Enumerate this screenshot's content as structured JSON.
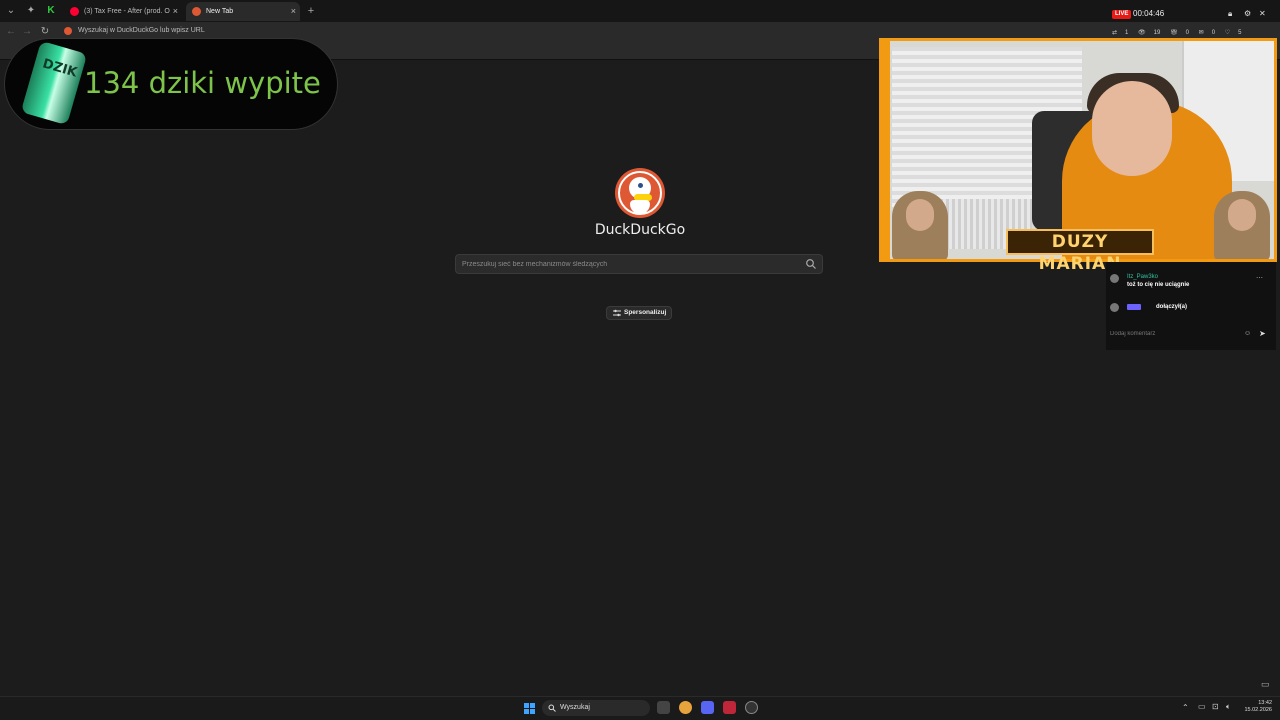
{
  "browser": {
    "tabs": [
      {
        "label": "(3) Tax Free - After (prod. O",
        "active": false
      },
      {
        "label": "New Tab",
        "active": true
      }
    ],
    "new_tab_symbol": "+",
    "close_symbol": "×",
    "address_placeholder": "Wyszukaj w DuckDuckGo lub wpisz URL"
  },
  "overlay": {
    "counter_text": "134 dziki wypite",
    "can_label": "DZIK"
  },
  "newtab": {
    "brand": "DuckDuckGo",
    "search_placeholder": "Przeszukuj sieć bez mechanizmów śledzących",
    "personalize_label": "Spersonalizuj"
  },
  "stream": {
    "live_label": "LIVE",
    "timer": "00:04:46",
    "stats": {
      "shares": "1",
      "viewers": "19",
      "gifts": "0",
      "comments": "0",
      "likes": "5"
    },
    "streamer_name": "DUZY MARIAN",
    "chat": {
      "messages": [
        {
          "user": "Itz_Paw3ko",
          "text": "toż to cię nie uciągnie"
        },
        {
          "user": "",
          "text": "dołączył(a)"
        }
      ],
      "input_placeholder": "Dodaj komentarz"
    }
  },
  "taskbar": {
    "search_label": "Wyszukaj",
    "time": "13:42",
    "date": "15.02.2026"
  },
  "colors": {
    "accent_orange": "#f29a12",
    "ddg_orange": "#de5833",
    "counter_green": "#7ec44a",
    "live_red": "#e91916"
  }
}
